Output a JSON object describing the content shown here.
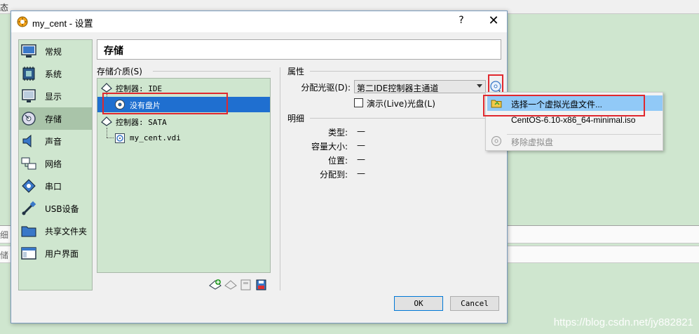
{
  "background": {
    "top_text": "态",
    "strip1_text": "细",
    "strip2_text": "储",
    "watermark": "https://blog.csdn.net/jy882821"
  },
  "dialog": {
    "title": "my_cent - 设置",
    "help": "?",
    "close": "✕"
  },
  "sidebar": {
    "items": [
      {
        "label": "常规",
        "icon": "general-icon"
      },
      {
        "label": "系统",
        "icon": "system-icon"
      },
      {
        "label": "显示",
        "icon": "display-icon"
      },
      {
        "label": "存储",
        "icon": "storage-icon",
        "selected": true
      },
      {
        "label": "声音",
        "icon": "audio-icon"
      },
      {
        "label": "网络",
        "icon": "network-icon"
      },
      {
        "label": "串口",
        "icon": "serial-port-icon"
      },
      {
        "label": "USB设备",
        "icon": "usb-icon"
      },
      {
        "label": "共享文件夹",
        "icon": "shared-folder-icon"
      },
      {
        "label": "用户界面",
        "icon": "user-interface-icon"
      }
    ]
  },
  "page": {
    "header": "存储"
  },
  "storage": {
    "media_label": "存储介质(S)",
    "tree": [
      {
        "label": "控制器: IDE",
        "type": "controller"
      },
      {
        "label": "没有盘片",
        "type": "optical",
        "selected": true
      },
      {
        "label": "控制器: SATA",
        "type": "controller"
      },
      {
        "label": "my_cent.vdi",
        "type": "disk"
      }
    ]
  },
  "attributes": {
    "title": "属性",
    "drive_label": "分配光驱(D):",
    "drive_value": "第二IDE控制器主通道",
    "live_cd_label": "演示(Live)光盘(L)",
    "live_cd_checked": false
  },
  "details": {
    "title": "明细",
    "rows": [
      {
        "label": "类型:",
        "value": "—"
      },
      {
        "label": "容量大小:",
        "value": "—"
      },
      {
        "label": "位置:",
        "value": "—"
      },
      {
        "label": "分配到:",
        "value": "—"
      }
    ]
  },
  "menu": {
    "items": [
      {
        "label": "选择一个虚拟光盘文件...",
        "highlighted": true
      },
      {
        "label": "CentOS-6.10-x86_64-minimal.iso"
      },
      {
        "label": "移除虚拟盘",
        "disabled": true
      }
    ]
  },
  "buttons": {
    "ok": "OK",
    "cancel": "Cancel"
  },
  "colors": {
    "selection": "#1f6fd0",
    "highlight_box": "#e0282e",
    "menu_highlight": "#91c9f7",
    "panel_green": "#cfe6cf"
  }
}
